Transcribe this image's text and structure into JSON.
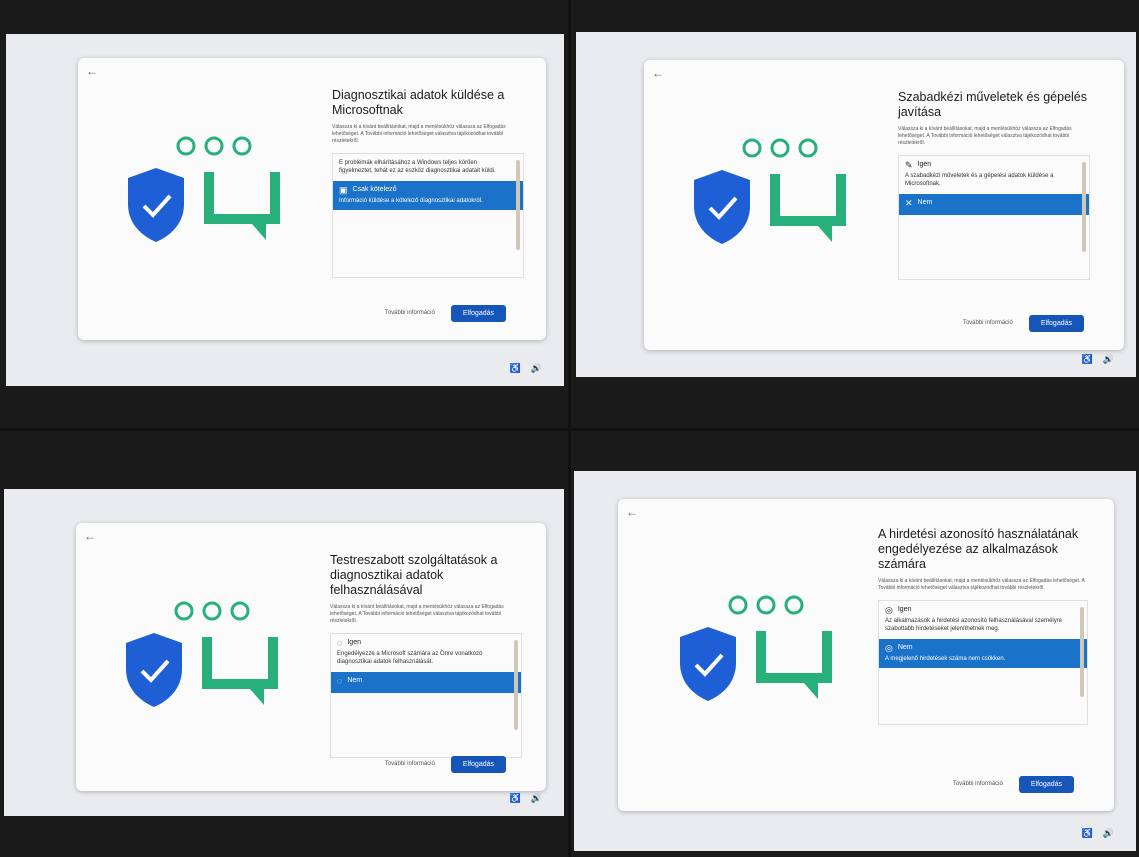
{
  "common": {
    "back_glyph": "←",
    "tray_access_glyph": "♿",
    "tray_volume_glyph": "🔊",
    "accent_color": "#1a73c8",
    "accept_color": "#1556b8",
    "illustration_green": "#27b07a",
    "illustration_shield": "#1f5fd6",
    "icons": [
      "back-arrow-icon",
      "shield-check-icon",
      "chat-bubble-icon",
      "accessibility-icon",
      "volume-icon"
    ]
  },
  "screens": [
    {
      "title": "Diagnosztikai adatok küldése a Microsoftnak",
      "description": "Válassza ki a kívánt beállításokat, majd a mentésükhöz válassza az Elfogadás lehetőséget. A További információ lehetőséget választva tájékozódhat további részletekről.",
      "intro": "E problémák elhárításához a Windows teljes körűen figyelmeztet, tehát ez az eszköz diagnosztikai adatait küldi.",
      "options": [
        {
          "label": "Csak kötelező",
          "text": "Információ küldése a kötelező diagnosztikai adatokról.",
          "selected": true
        }
      ],
      "more_info_label": "További információ",
      "accept_label": "Elfogadás"
    },
    {
      "title": "Szabadkézi műveletek és gépelés javítása",
      "description": "Válassza ki a kívánt beállításokat, majd a mentésükhöz válassza az Elfogadás lehetőséget. A További információ lehetőséget választva tájékozódhat további részletekről.",
      "options": [
        {
          "label": "Igen",
          "text": "A szabadkézi műveletek és a gépelési adatok küldése a Microsoftnak.",
          "selected": false
        },
        {
          "label": "Nem",
          "text": "",
          "selected": true
        }
      ],
      "more_info_label": "További információ",
      "accept_label": "Elfogadás"
    },
    {
      "title": "Testreszabott szolgáltatások a diagnosztikai adatok felhasználásával",
      "description": "Válassza ki a kívánt beállításokat, majd a mentésükhöz válassza az Elfogadás lehetőséget. A További információ lehetőséget választva tájékozódhat további részletekről.",
      "options": [
        {
          "label": "Igen",
          "text": "Engedélyezze a Microsoft számára az Önre vonatkozó diagnosztikai adatok felhasználását.",
          "selected": false
        },
        {
          "label": "Nem",
          "text": "",
          "selected": true
        }
      ],
      "more_info_label": "További információ",
      "accept_label": "Elfogadás"
    },
    {
      "title": "A hirdetési azonosító használatának engedélyezése az alkalmazások számára",
      "description": "Válassza ki a kívánt beállításokat, majd a mentésükhöz válassza az Elfogadás lehetőséget. A További információ lehetőséget választva tájékozódhat további részletekről.",
      "options": [
        {
          "label": "Igen",
          "text": "Az alkalmazások a hirdetési azonosító felhasználásával személyre szabottabb hirdetéseket jeleníthetnek meg.",
          "selected": false
        },
        {
          "label": "Nem",
          "text": "A megjelenő hirdetések száma nem csökken.",
          "selected": true
        }
      ],
      "more_info_label": "További információ",
      "accept_label": "Elfogadás"
    }
  ]
}
